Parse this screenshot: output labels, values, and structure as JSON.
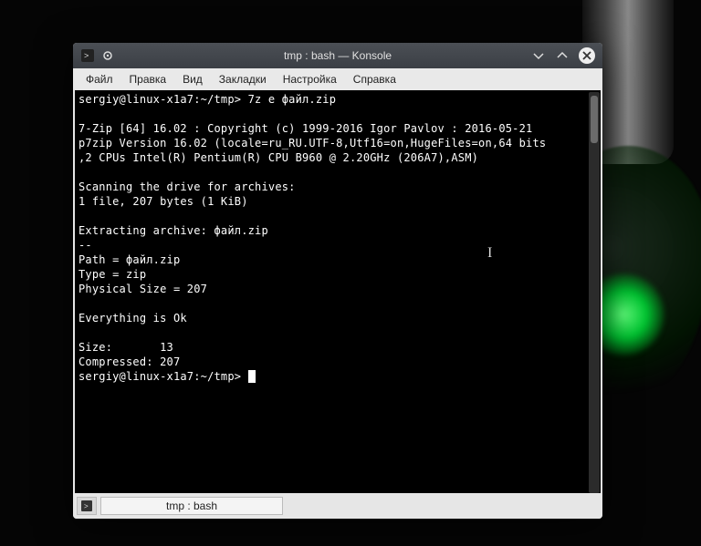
{
  "window": {
    "title": "tmp : bash — Konsole"
  },
  "menubar": {
    "items": [
      "Файл",
      "Правка",
      "Вид",
      "Закладки",
      "Настройка",
      "Справка"
    ]
  },
  "terminal": {
    "lines": [
      "sergiy@linux-x1a7:~/tmp> 7z e файл.zip",
      "",
      "7-Zip [64] 16.02 : Copyright (c) 1999-2016 Igor Pavlov : 2016-05-21",
      "p7zip Version 16.02 (locale=ru_RU.UTF-8,Utf16=on,HugeFiles=on,64 bits",
      ",2 CPUs Intel(R) Pentium(R) CPU B960 @ 2.20GHz (206A7),ASM)",
      "",
      "Scanning the drive for archives:",
      "1 file, 207 bytes (1 KiB)",
      "",
      "Extracting archive: файл.zip",
      "--",
      "Path = файл.zip",
      "Type = zip",
      "Physical Size = 207",
      "",
      "Everything is Ok",
      "",
      "Size:       13",
      "Compressed: 207"
    ],
    "prompt": "sergiy@linux-x1a7:~/tmp> "
  },
  "tabbar": {
    "tab_label": "tmp : bash"
  }
}
